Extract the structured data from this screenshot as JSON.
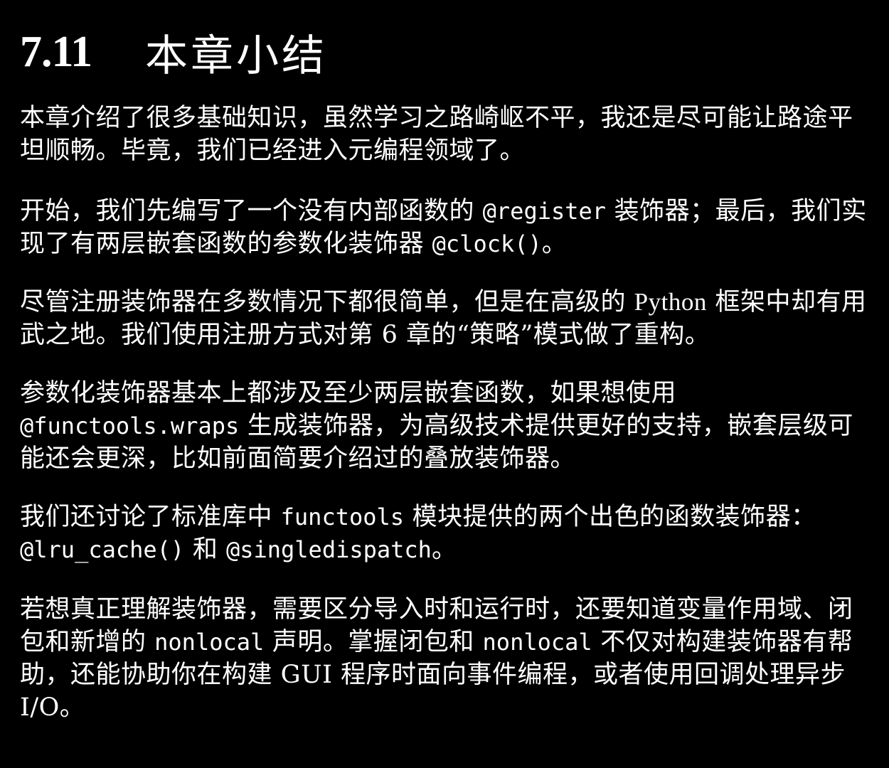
{
  "heading": {
    "number": "7.11",
    "title": "本章小结"
  },
  "paragraphs": {
    "p1": {
      "t1": "本章介绍了很多基础知识，虽然学习之路崎岖不平，我还是尽可能让路途平坦顺畅。毕竟，我们已经进入元编程领域了。"
    },
    "p2": {
      "t1": "开始，我们先编写了一个没有内部函数的 ",
      "c1": "@register",
      "t2": " 装饰器；最后，我们实现了有两层嵌套函数的参数化装饰器 ",
      "c2": "@clock()",
      "t3": "。"
    },
    "p3": {
      "t1": "尽管注册装饰器在多数情况下都很简单，但是在高级的 ",
      "l1": "Python",
      "t2": " 框架中却有用武之地。我们使用注册方式对第 6 章的“策略”模式做了重构。"
    },
    "p4": {
      "t1": "参数化装饰器基本上都涉及至少两层嵌套函数，如果想使用",
      "c1": "@functools.wraps",
      "t2": " 生成装饰器，为高级技术提供更好的支持，嵌套层级可能还会更深，比如前面简要介绍过的叠放装饰器。"
    },
    "p5": {
      "t1": "我们还讨论了标准库中 ",
      "c1": "functools",
      "t2": " 模块提供的两个出色的函数装饰器：",
      "c2": "@lru_cache()",
      "t3": " 和 ",
      "c3": "@singledispatch",
      "t4": "。"
    },
    "p6": {
      "t1": "若想真正理解装饰器，需要区分导入时和运行时，还要知道变量作用域、闭包和新增的 ",
      "c1": "nonlocal",
      "t2": " 声明。掌握闭包和 ",
      "c2": "nonlocal",
      "t3": " 不仅对构建装饰器有帮助，还能协助你在构建 GUI 程序时面向事件编程，或者使用回调处理异步 I/O。"
    }
  }
}
